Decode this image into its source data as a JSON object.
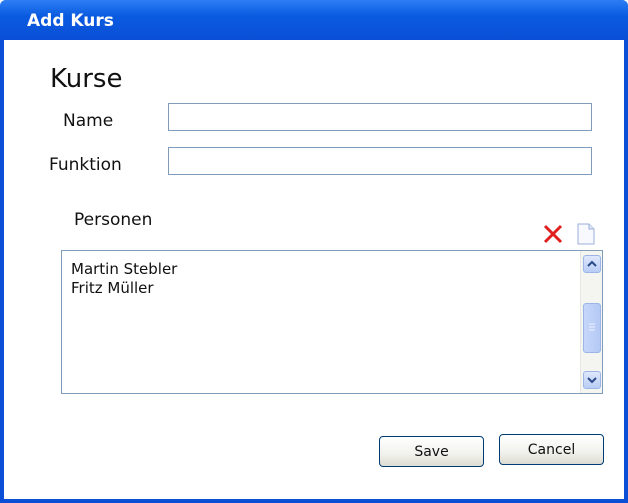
{
  "window": {
    "title": "Add Kurs"
  },
  "form": {
    "heading": "Kurse",
    "name_label": "Name",
    "name_value": "",
    "funktion_label": "Funktion",
    "funktion_value": "",
    "personen_label": "Personen"
  },
  "toolbar": {
    "delete_icon": "delete-x-icon",
    "new_icon": "new-document-icon",
    "delete_color": "#e02020"
  },
  "personen_list": {
    "items": [
      "Martin Stebler",
      "Fritz Müller"
    ]
  },
  "buttons": {
    "save_label": "Save",
    "cancel_label": "Cancel"
  },
  "colors": {
    "titlebar": "#0a4fd6",
    "border": "#7f9db9"
  }
}
